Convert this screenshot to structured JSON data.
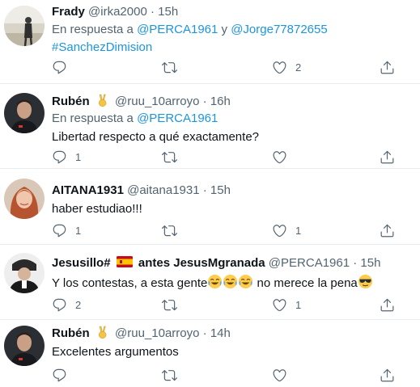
{
  "tweets": [
    {
      "name": "Frady",
      "handle": "@irka2000",
      "dot": "·",
      "time": "15h",
      "reply_prefix": "En respuesta a",
      "reply_to": "@PERCA1961",
      "reply_and": "y",
      "reply_to2": "@Jorge77872655",
      "hashtag": "#SanchezDimision",
      "replies": "",
      "retweets": "",
      "likes": "2"
    },
    {
      "name": "Rubén",
      "badge_icon": "victory-hand-emoji",
      "handle": "@ruu_10arroyo",
      "dot": "·",
      "time": "16h",
      "reply_prefix": "En respuesta a",
      "reply_to": "@PERCA1961",
      "text": "Libertad respecto a qué exactamente?",
      "replies": "1",
      "retweets": "",
      "likes": ""
    },
    {
      "name": "AITANA1931",
      "handle": "@aitana1931",
      "dot": "·",
      "time": "15h",
      "text": "haber estudiao!!!",
      "replies": "1",
      "retweets": "",
      "likes": "1"
    },
    {
      "name_part1": "Jesusillo#",
      "flag_icon": "spain-flag-emoji",
      "name_part2": "antes JesusMgranada",
      "handle": "@PERCA1961",
      "dot": "·",
      "time": "15h",
      "text_part1": "Y los contestas, a esta gente",
      "emojis": [
        "tears-of-joy-emoji",
        "tears-of-joy-emoji",
        "tears-of-joy-emoji",
        "sunglasses-emoji"
      ],
      "text_part2": "no merece la pena",
      "replies": "2",
      "retweets": "",
      "likes": "1"
    },
    {
      "name": "Rubén",
      "badge_icon": "victory-hand-emoji",
      "handle": "@ruu_10arroyo",
      "dot": "·",
      "time": "14h",
      "text": "Excelentes argumentos",
      "replies": "",
      "retweets": "",
      "likes": ""
    }
  ],
  "colors": {
    "link": "#1b95e0",
    "secondary_text": "#536471",
    "icon": "#536471",
    "divider": "#e6ecf0"
  }
}
